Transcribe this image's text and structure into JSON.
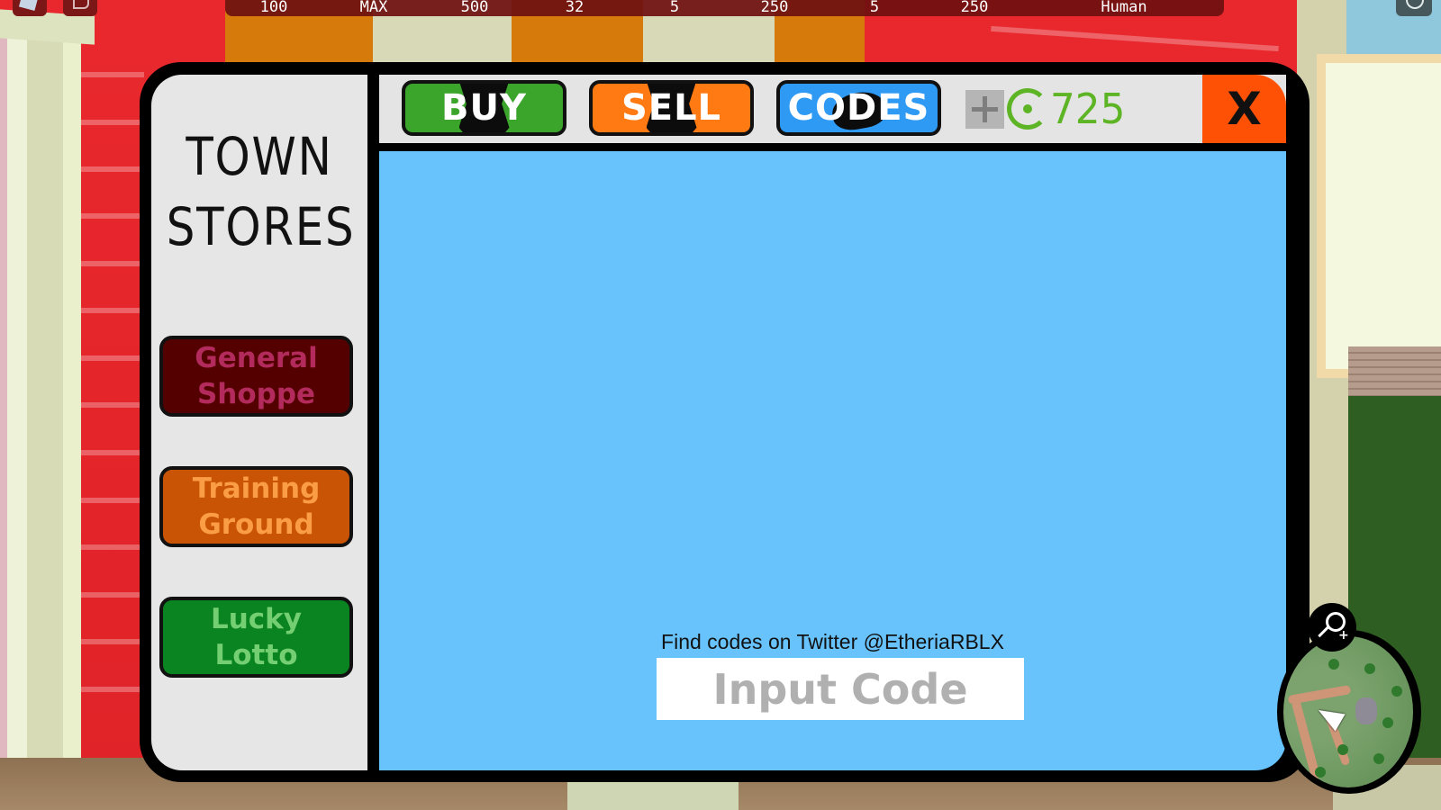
{
  "hud": {
    "stats": [
      "100",
      "MAX",
      "500",
      "32",
      "5",
      "250",
      "5",
      "250",
      "Human"
    ],
    "icons": [
      "roblox-menu-icon",
      "chat-icon",
      "settings-icon"
    ]
  },
  "dialog": {
    "title_line1": "TOWN",
    "title_line2": "STORES",
    "stores": [
      {
        "id": "general",
        "line1": "General",
        "line2": "Shoppe",
        "bg": "#550000",
        "fg": "#b32b5c"
      },
      {
        "id": "training",
        "line1": "Training",
        "line2": "Ground",
        "bg": "#c95406",
        "fg": "#fb9d45"
      },
      {
        "id": "lotto",
        "line1": "Lucky",
        "line2": "Lotto",
        "bg": "#0a8421",
        "fg": "#74cf72"
      }
    ],
    "tabs": {
      "buy": "BUY",
      "sell": "SELL",
      "codes": "CODES"
    },
    "currency": {
      "amount": "725",
      "color": "#5db424",
      "add_label": "+"
    },
    "close_label": "X",
    "codes_panel": {
      "note": "Find codes on Twitter @EtheriaRBLX",
      "input_placeholder": "Input Code",
      "input_value": ""
    }
  },
  "colors": {
    "buy": "#3aa52a",
    "sell": "#ff7a12",
    "codes": "#2e9af4",
    "close": "#ff5105",
    "content_bg": "#68c3fd",
    "panel_bg": "#e6e6e6"
  }
}
